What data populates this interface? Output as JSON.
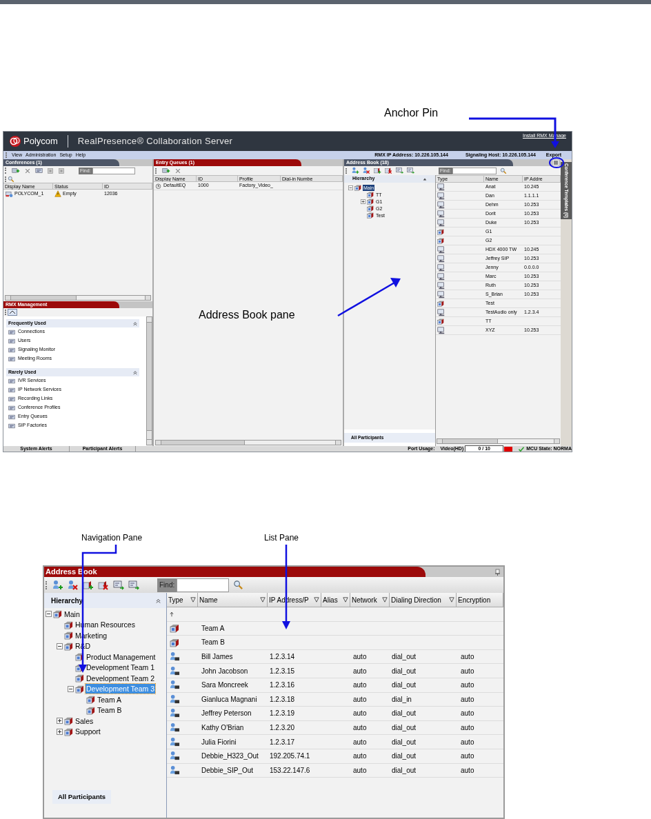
{
  "top_screenshot": {
    "header": {
      "brand": "Polycom",
      "product": "RealPresence® Collaboration Server",
      "link": "Install RMX Manage"
    },
    "menu": [
      "View",
      "Administration",
      "Setup",
      "Help"
    ],
    "info": [
      "RMX IP Address: 10.226.105.144",
      "Signaling Host: 10.226.105.144",
      "Export"
    ],
    "conferences": {
      "title": "Conferences (1)",
      "find_label": "Find:",
      "columns": [
        "Display Name",
        "Status",
        "ID"
      ],
      "rows": [
        {
          "name": "POLYCOM_1",
          "status": "Empty",
          "id": "12036"
        }
      ]
    },
    "rmx_management": {
      "title": "RMX Management",
      "sections": [
        {
          "title": "Frequently Used",
          "items": [
            "Connections",
            "Users",
            "Signaling Monitor",
            "Meeting Rooms"
          ]
        },
        {
          "title": "Rarely Used",
          "items": [
            "IVR Services",
            "IP Network Services",
            "Recording Links",
            "Conference Profiles",
            "Entry Queues",
            "SIP Factories"
          ]
        }
      ]
    },
    "entry_queues": {
      "title": "Entry Queues (1)",
      "columns": [
        "Display Name",
        "ID",
        "Profile",
        "Dial-in Numbe"
      ],
      "rows": [
        {
          "name": "DefaultEQ",
          "id": "1000",
          "profile": "Factory_Video_"
        }
      ]
    },
    "address_book": {
      "title": "Address Book (18)",
      "find_label": "Find:",
      "hierarchy_label": "Hierarchy",
      "tree": [
        {
          "label": "Main",
          "selected": true,
          "expanded": true,
          "children": [
            {
              "label": "TT",
              "selected": false
            },
            {
              "label": "G1",
              "selected": false,
              "expanded": false
            },
            {
              "label": "G2",
              "selected": false
            },
            {
              "label": "Test",
              "selected": false
            }
          ]
        }
      ],
      "all_participants": "All Participants",
      "columns": [
        "Type",
        "Name",
        "IP Addre"
      ],
      "rows": [
        {
          "kind": "participant",
          "name": "Anat",
          "ip": "10.245"
        },
        {
          "kind": "participant",
          "name": "Dan",
          "ip": "1.1.1.1"
        },
        {
          "kind": "participant",
          "name": "Dehm",
          "ip": "10.253"
        },
        {
          "kind": "participant",
          "name": "Dorit",
          "ip": "10.253"
        },
        {
          "kind": "participant",
          "name": "Duke",
          "ip": "10.253"
        },
        {
          "kind": "group",
          "name": "G1"
        },
        {
          "kind": "group",
          "name": "G2"
        },
        {
          "kind": "participant",
          "name": "HDX 4000 TW",
          "ip": "10.245"
        },
        {
          "kind": "participant",
          "name": "Jeffrey SIP",
          "ip": "10.253"
        },
        {
          "kind": "participant",
          "name": "Jenny",
          "ip": "0.0.0.0"
        },
        {
          "kind": "participant",
          "name": "Marc",
          "ip": "10.253"
        },
        {
          "kind": "participant",
          "name": "Ruth",
          "ip": "10.253"
        },
        {
          "kind": "participant",
          "name": "S_Brian",
          "ip": "10.253"
        },
        {
          "kind": "group",
          "name": "Test"
        },
        {
          "kind": "participant",
          "name": "TestAudio only",
          "ip": "1.2.3.4"
        },
        {
          "kind": "group",
          "name": "TT"
        },
        {
          "kind": "participant",
          "name": "XYZ",
          "ip": "10.253"
        }
      ]
    },
    "side_tab": "Conference Templates (0)",
    "status_bar": {
      "alerts": [
        "System Alerts",
        "Participant Alerts"
      ],
      "port_usage_label": "Port Usage:",
      "port_type": "Video(HD)",
      "port_count": "0 / 10",
      "mcu_state": "MCU State: NORMA"
    }
  },
  "annotations": [
    {
      "label": "Anchor Pin"
    },
    {
      "label": "Address Book pane"
    },
    {
      "label": "Navigation Pane"
    },
    {
      "label": "List Pane"
    }
  ],
  "bottom_screenshot": {
    "title": "Address Book",
    "find_label": "Find:",
    "hierarchy_label": "Hierarchy",
    "tree": [
      {
        "label": "Main",
        "selected": false,
        "expanded": true,
        "children": [
          {
            "label": "Human Resources",
            "selected": false
          },
          {
            "label": "Marketing",
            "selected": false
          },
          {
            "label": "R&D",
            "selected": false,
            "expanded": true,
            "children": [
              {
                "label": "Product Management",
                "selected": false
              },
              {
                "label": "Development Team 1",
                "selected": false
              },
              {
                "label": "Development Team 2",
                "selected": false
              },
              {
                "label": "Development Team 3",
                "selected": true,
                "expanded": true,
                "children": [
                  {
                    "label": "Team A",
                    "selected": false
                  },
                  {
                    "label": "Team B",
                    "selected": false
                  }
                ]
              }
            ]
          },
          {
            "label": "Sales",
            "selected": false,
            "expanded": false
          },
          {
            "label": "Support",
            "selected": false,
            "expanded": false
          }
        ]
      }
    ],
    "all_participants": "All Participants",
    "columns": [
      {
        "label": "Type",
        "filter": true
      },
      {
        "label": "Name",
        "filter": true
      },
      {
        "label": "IP Address/P",
        "filter": true
      },
      {
        "label": "Alias",
        "filter": true
      },
      {
        "label": "Network",
        "filter": true
      },
      {
        "label": "Dialing Direction",
        "filter": true
      },
      {
        "label": "Encryption",
        "filter": false
      }
    ],
    "rows": [
      {
        "kind": "parent"
      },
      {
        "kind": "group",
        "name": "Team A"
      },
      {
        "kind": "group",
        "name": "Team B"
      },
      {
        "kind": "participant",
        "name": "Bill James",
        "ip": "1.2.3.14",
        "network": "auto",
        "dialing_direction": "dial_out",
        "encryption": "auto"
      },
      {
        "kind": "participant",
        "name": "John Jacobson",
        "ip": "1.2.3.15",
        "network": "auto",
        "dialing_direction": "dial_out",
        "encryption": "auto"
      },
      {
        "kind": "participant",
        "name": "Sara Moncreek",
        "ip": "1.2.3.16",
        "network": "auto",
        "dialing_direction": "dial_out",
        "encryption": "auto"
      },
      {
        "kind": "participant",
        "name": "Gianluca Magnani",
        "ip": "1.2.3.18",
        "network": "auto",
        "dialing_direction": "dial_in",
        "encryption": "auto"
      },
      {
        "kind": "participant",
        "name": "Jeffrey Peterson",
        "ip": "1.2.3.19",
        "network": "auto",
        "dialing_direction": "dial_out",
        "encryption": "auto"
      },
      {
        "kind": "participant",
        "name": "Kathy O'Brian",
        "ip": "1.2.3.20",
        "network": "auto",
        "dialing_direction": "dial_out",
        "encryption": "auto"
      },
      {
        "kind": "participant",
        "name": "Julia Fiorini",
        "ip": "1.2.3.17",
        "network": "auto",
        "dialing_direction": "dial_out",
        "encryption": "auto"
      },
      {
        "kind": "participant",
        "name": "Debbie_H323_Out",
        "ip": "192.205.74.1",
        "network": "auto",
        "dialing_direction": "dial_out",
        "encryption": "auto"
      },
      {
        "kind": "participant",
        "name": "Debbie_SIP_Out",
        "ip": "153.22.147.6",
        "network": "auto",
        "dialing_direction": "dial_out",
        "encryption": "auto"
      }
    ]
  }
}
